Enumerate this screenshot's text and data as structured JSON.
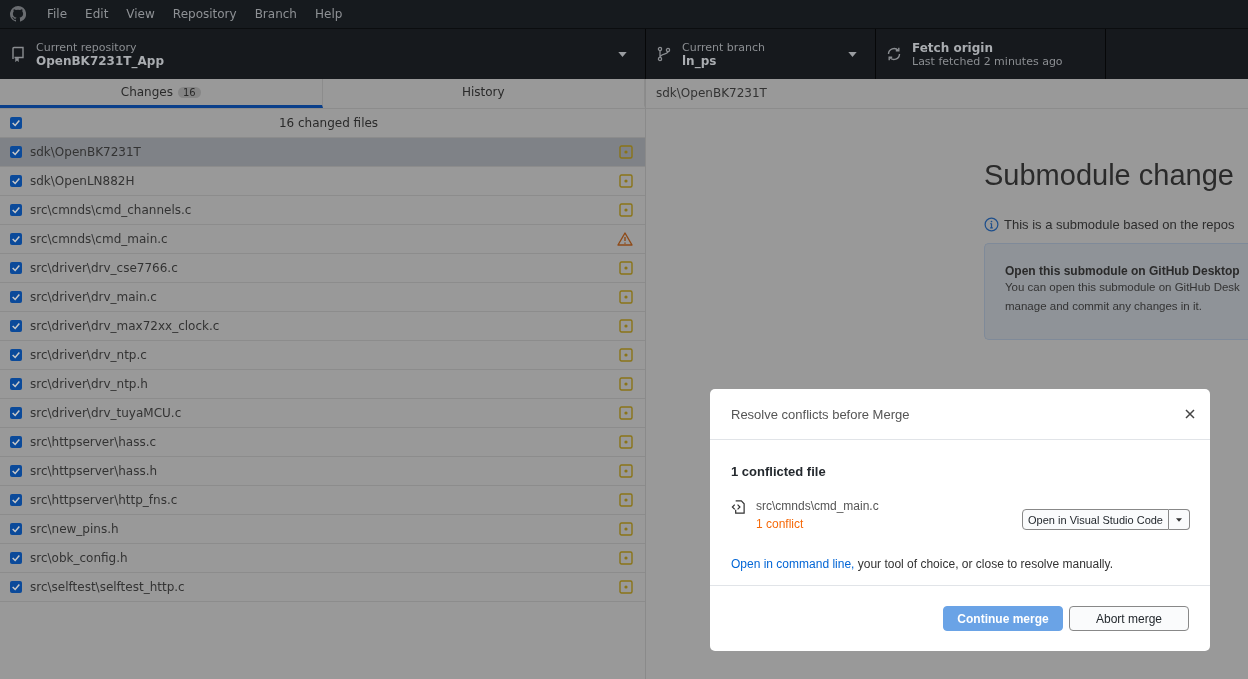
{
  "menu": [
    "File",
    "Edit",
    "View",
    "Repository",
    "Branch",
    "Help"
  ],
  "toolbar": {
    "repository": {
      "label": "Current repository",
      "value": "OpenBK7231T_App"
    },
    "branch": {
      "label": "Current branch",
      "value": "ln_ps"
    },
    "fetch": {
      "title": "Fetch origin",
      "subtitle": "Last fetched 2 minutes ago"
    }
  },
  "tabs": [
    {
      "label": "Changes",
      "count": "16",
      "selected": true
    },
    {
      "label": "History",
      "selected": false
    }
  ],
  "changes": {
    "summary": "16 changed files",
    "all_checked": true,
    "files": [
      {
        "path": "sdk\\OpenBK7231T",
        "checked": true,
        "selected": true,
        "kind": "modified"
      },
      {
        "path": "sdk\\OpenLN882H",
        "checked": true,
        "selected": false,
        "kind": "modified"
      },
      {
        "path": "src\\cmnds\\cmd_channels.c",
        "checked": true,
        "selected": false,
        "kind": "modified"
      },
      {
        "path": "src\\cmnds\\cmd_main.c",
        "checked": true,
        "selected": false,
        "kind": "conflicted"
      },
      {
        "path": "src\\driver\\drv_cse7766.c",
        "checked": true,
        "selected": false,
        "kind": "modified"
      },
      {
        "path": "src\\driver\\drv_main.c",
        "checked": true,
        "selected": false,
        "kind": "modified"
      },
      {
        "path": "src\\driver\\drv_max72xx_clock.c",
        "checked": true,
        "selected": false,
        "kind": "modified"
      },
      {
        "path": "src\\driver\\drv_ntp.c",
        "checked": true,
        "selected": false,
        "kind": "modified"
      },
      {
        "path": "src\\driver\\drv_ntp.h",
        "checked": true,
        "selected": false,
        "kind": "modified"
      },
      {
        "path": "src\\driver\\drv_tuyaMCU.c",
        "checked": true,
        "selected": false,
        "kind": "modified"
      },
      {
        "path": "src\\httpserver\\hass.c",
        "checked": true,
        "selected": false,
        "kind": "modified"
      },
      {
        "path": "src\\httpserver\\hass.h",
        "checked": true,
        "selected": false,
        "kind": "modified"
      },
      {
        "path": "src\\httpserver\\http_fns.c",
        "checked": true,
        "selected": false,
        "kind": "modified"
      },
      {
        "path": "src\\new_pins.h",
        "checked": true,
        "selected": false,
        "kind": "modified"
      },
      {
        "path": "src\\obk_config.h",
        "checked": true,
        "selected": false,
        "kind": "modified"
      },
      {
        "path": "src\\selftest\\selftest_http.c",
        "checked": true,
        "selected": false,
        "kind": "modified"
      }
    ]
  },
  "diff": {
    "path": "sdk\\OpenBK7231T",
    "heading": "Submodule change",
    "info": "This is a submodule based on the repos",
    "card": {
      "title": "Open this submodule on GitHub Desktop",
      "text": "You can open this submodule on GitHub Desk manage and commit any changes in it."
    }
  },
  "dialog": {
    "title": "Resolve conflicts before Merge",
    "heading": "1 conflicted file",
    "file": {
      "path": "src\\cmnds\\cmd_main.c",
      "status": "1 conflict"
    },
    "open_button": "Open in Visual Studio Code",
    "link": "Open in command line,",
    "note": " your tool of choice, or close to resolve manually.",
    "buttons": [
      {
        "label": "Continue merge",
        "kind": "primary"
      },
      {
        "label": "Abort merge",
        "kind": "secondary"
      }
    ]
  }
}
